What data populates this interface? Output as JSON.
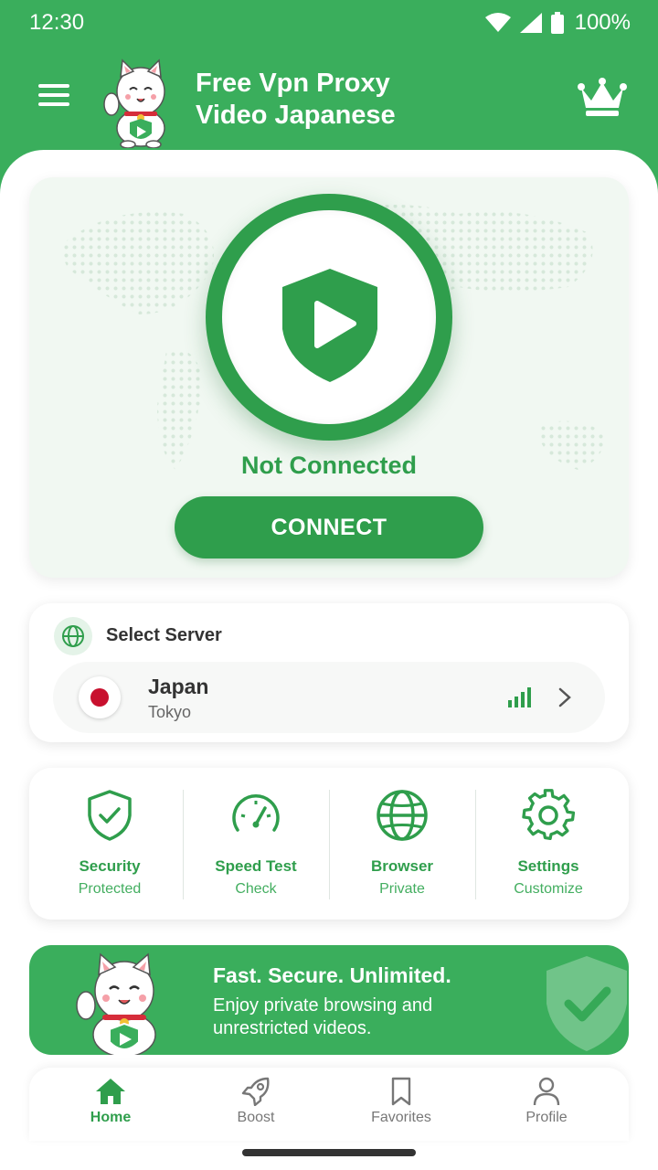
{
  "status_bar": {
    "time": "12:30",
    "battery": "100%"
  },
  "app": {
    "title_line1": "Free Vpn Proxy",
    "title_line2": "Video Japanese"
  },
  "hero": {
    "status": "Not Connected",
    "connect_label": "CONNECT"
  },
  "server": {
    "header": "Select Server",
    "country": "Japan",
    "city": "Tokyo"
  },
  "features": [
    {
      "title": "Security",
      "subtitle": "Protected",
      "icon": "shield-check-icon"
    },
    {
      "title": "Speed Test",
      "subtitle": "Check",
      "icon": "speedometer-icon"
    },
    {
      "title": "Browser",
      "subtitle": "Private",
      "icon": "globe-icon"
    },
    {
      "title": "Settings",
      "subtitle": "Customize",
      "icon": "gear-icon"
    }
  ],
  "promo": {
    "title": "Fast. Secure. Unlimited.",
    "text": "Enjoy private browsing and unrestricted videos."
  },
  "nav": [
    {
      "label": "Home",
      "icon": "home-icon",
      "active": true
    },
    {
      "label": "Boost",
      "icon": "rocket-icon",
      "active": false
    },
    {
      "label": "Favorites",
      "icon": "bookmark-icon",
      "active": false
    },
    {
      "label": "Profile",
      "icon": "person-icon",
      "active": false
    }
  ],
  "colors": {
    "primary": "#3aae5c",
    "primary_dark": "#2f9e4c",
    "flag_red": "#c8102e"
  }
}
